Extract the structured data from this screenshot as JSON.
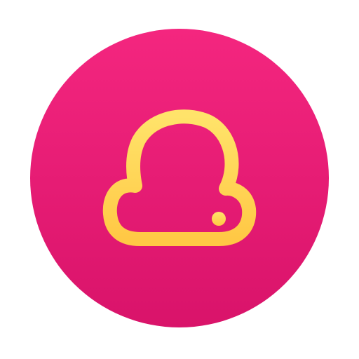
{
  "icon": {
    "name": "cloud-app-icon",
    "glyph": "cloud-icon",
    "colors": {
      "background_top": "#F4267F",
      "background_bottom": "#D9136A",
      "glyph_top": "#FFE36A",
      "glyph_bottom": "#FFC845"
    }
  }
}
